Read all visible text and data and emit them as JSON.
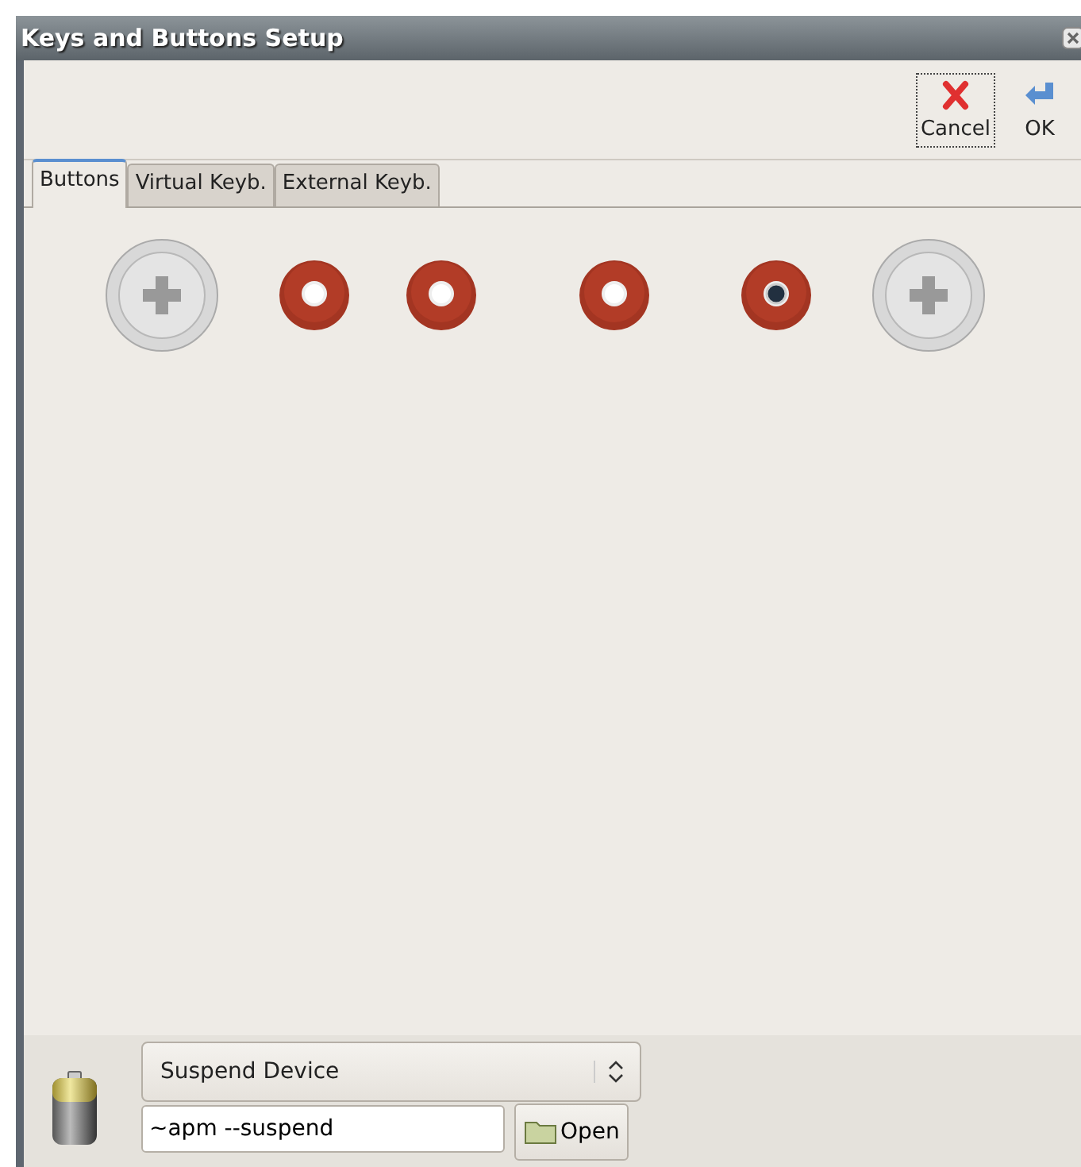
{
  "window": {
    "title": "Keys and Buttons Setup"
  },
  "toolbar": [
    {
      "kind": "cancel",
      "label": "Cancel",
      "focused": true
    },
    {
      "kind": "ok",
      "label": "OK",
      "focused": false
    }
  ],
  "tabs": [
    {
      "label": "Buttons",
      "selected": true
    },
    {
      "label": "Virtual Keyb.",
      "selected": false
    },
    {
      "label": "External Keyb.",
      "selected": false
    }
  ],
  "device_buttons": [
    {
      "kind": "screw",
      "selected": false
    },
    {
      "kind": "key",
      "selected": false
    },
    {
      "kind": "key",
      "selected": false
    },
    {
      "kind": "key",
      "selected": false
    },
    {
      "kind": "key",
      "selected": true
    },
    {
      "kind": "screw",
      "selected": false
    }
  ],
  "action": {
    "choice": "Suspend Device",
    "command": "~apm --suspend",
    "open_button": "Open"
  }
}
